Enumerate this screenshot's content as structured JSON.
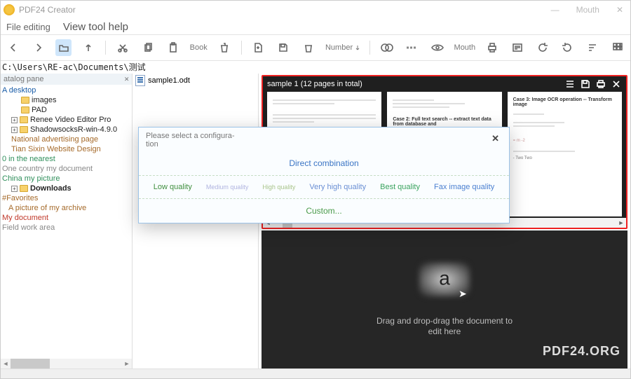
{
  "titlebar": {
    "app_name": "PDF24 Creator",
    "min": "—",
    "max": "Mouth",
    "close": "✕"
  },
  "menubar": {
    "file_editing": "File editing",
    "view_tool_help": "View tool help"
  },
  "toolbar": {
    "book": "Book",
    "number": "Number",
    "mouth": "Mouth"
  },
  "pathbar": {
    "path": "C:\\Users\\RE-ac\\Documents\\测试"
  },
  "catalog": {
    "heading": "atalog pane",
    "close": "✕"
  },
  "tree": {
    "desktop": "A desktop",
    "images": "images",
    "pad": "PAD",
    "renee": "Renee Video Editor Pro",
    "shadowsocks": "ShadowsocksR-win-4.9.0",
    "national_ad": "National advertising page",
    "tiansixin": "Tian Sixin Website Design",
    "nearest": "0 in the nearest",
    "one_country": "One country my document",
    "china": "China my picture",
    "downloads": "Downloads",
    "favorites": "#Favorites",
    "picture_archive": "A picture of my archive",
    "my_document": "My document",
    "field_work": "Field work area"
  },
  "midpanel": {
    "file1": "sample1.odt"
  },
  "preview": {
    "title": "sample 1 (12 pages in total)"
  },
  "pages": {
    "p2_case2": "Case 2:",
    "p2_case2_text": "Full text search -- extract text data from database and",
    "p3_case3": "Case 3:",
    "p3_case3_text": "Image OCR operation -- Transform image",
    "p3_m2": "= m -2",
    "p3_twotwo": "- Two Two"
  },
  "darkarea": {
    "hint1": "Drag and drop-drag the document to",
    "hint2": "edit here"
  },
  "brand": "PDF24.ORG",
  "modal": {
    "prompt": "Please select a configura-\ntion",
    "direct": "Direct combination",
    "low": "Low quality",
    "med": "Medium quality",
    "high": "High quality",
    "vhigh": "Very high quality",
    "best": "Best quality",
    "fax": "Fax image quality",
    "custom": "Custom...",
    "close": "✕"
  }
}
